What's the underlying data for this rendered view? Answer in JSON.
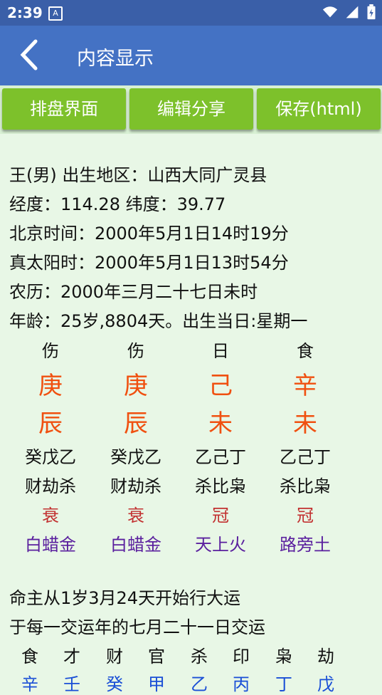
{
  "status": {
    "time": "2:39",
    "note_icon": "A"
  },
  "appbar": {
    "title": "内容显示"
  },
  "toolbar": {
    "btn1": "排盘界面",
    "btn2": "编辑分享",
    "btn3": "保存(html)"
  },
  "info": {
    "line1": "王(男) 出生地区：山西大同广灵县",
    "line2": "经度：114.28 纬度：39.77",
    "line3": "北京时间：2000年5月1日14时19分",
    "line4": "真太阳时：2000年5月1日13时54分",
    "line5": "农历：2000年三月二十七日未时",
    "line6": "年龄：25岁,8804天。出生当日:星期一"
  },
  "pillars": {
    "shishen": [
      "伤",
      "伤",
      "日",
      "食"
    ],
    "gan": [
      "庚",
      "庚",
      "己",
      "辛"
    ],
    "zhi": [
      "辰",
      "辰",
      "未",
      "未"
    ],
    "canggan": [
      "癸戊乙",
      "癸戊乙",
      "乙己丁",
      "乙己丁"
    ],
    "cangshishen": [
      "财劫杀",
      "财劫杀",
      "杀比枭",
      "杀比枭"
    ],
    "state": [
      "衰",
      "衰",
      "冠",
      "冠"
    ],
    "nayin": [
      "白蜡金",
      "白蜡金",
      "天上火",
      "路旁土"
    ]
  },
  "dayun": {
    "line1": "命主从1岁3月24天开始行大运",
    "line2": "于每一交运年的七月二十一日交运",
    "shishen": [
      "食",
      "才",
      "财",
      "官",
      "杀",
      "印",
      "枭",
      "劫"
    ],
    "gan": [
      "辛",
      "壬",
      "癸",
      "甲",
      "乙",
      "丙",
      "丁",
      "戊"
    ]
  },
  "colors": {
    "statusbar": "#3a5fa8",
    "appbar": "#4472c4",
    "button": "#7dc12b",
    "ganzhi": "#f05010",
    "nayin": "#5a1f9e",
    "state": "#c23030"
  }
}
